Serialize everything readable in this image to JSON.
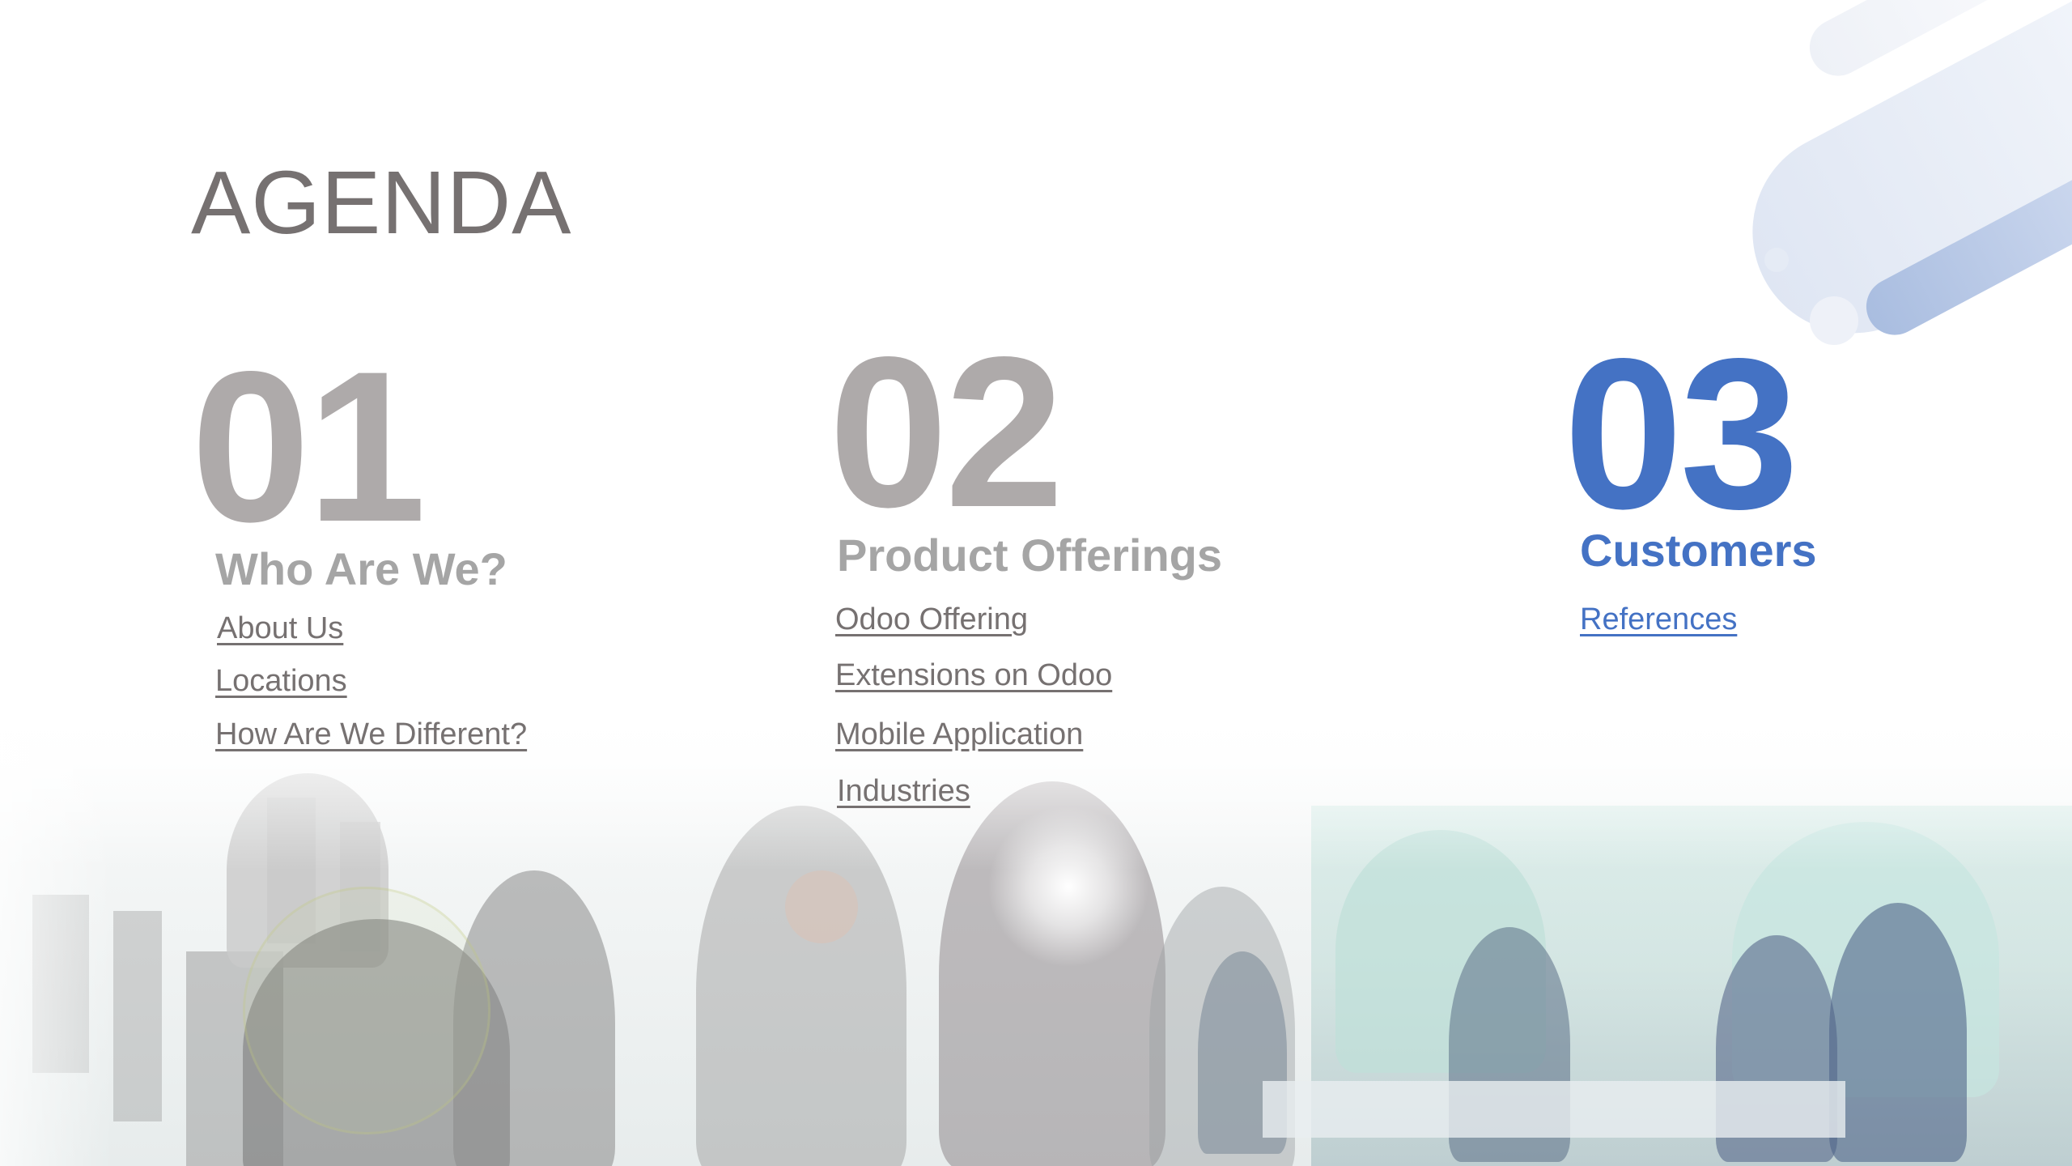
{
  "slide": {
    "title": "AGENDA",
    "sections": [
      {
        "number": "01",
        "heading": "Who Are We?",
        "links": [
          "About Us",
          "Locations",
          "How Are We Different?"
        ]
      },
      {
        "number": "02",
        "heading": "Product Offerings",
        "links": [
          "Odoo Offering",
          "Extensions on Odoo",
          "Mobile Application",
          "Industries"
        ]
      },
      {
        "number": "03",
        "heading": "Customers",
        "links": [
          "References"
        ]
      }
    ]
  },
  "colors": {
    "title": "#767171",
    "number_gray": "#aeaaaa",
    "heading_gray": "#a5a5a5",
    "accent_blue": "#4472c4",
    "link_gray": "#767171"
  },
  "images": {
    "background_photo": "faded-office-meeting-photo",
    "decoration": "blue-pill-shapes"
  }
}
